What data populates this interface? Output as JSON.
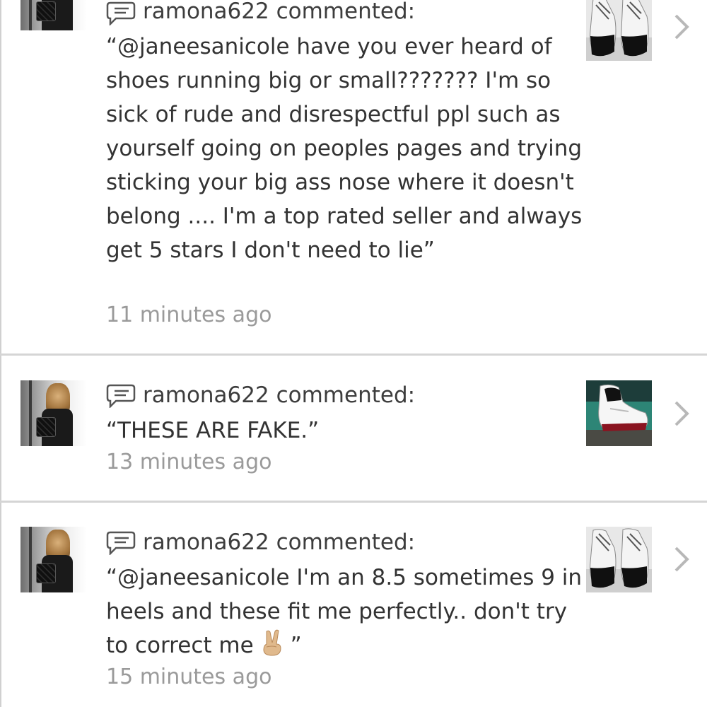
{
  "comments": [
    {
      "username": "ramona622",
      "action": "commented:",
      "text": "“@janeesanicole have you ever heard of shoes running big or small??????? I'm so sick of rude and disrespectful ppl such as yourself going on peoples pages and trying sticking your big ass nose where it doesn't belong .... I'm a top rated seller and always get 5 stars I don't need to lie”",
      "time": "11 minutes ago",
      "thumb_icon": "sneaker-photo-black-white"
    },
    {
      "username": "ramona622",
      "action": "commented:",
      "text": "“THESE ARE FAKE.”",
      "time": "13 minutes ago",
      "thumb_icon": "sneaker-photo-white-red"
    },
    {
      "username": "ramona622",
      "action": "commented:",
      "text_before_emoji": "“@janeesanicole I'm an 8.5 sometimes 9 in heels and these fit me perfectly.. don't try to correct me",
      "text_after_emoji": "”",
      "emoji": "victory-hand-emoji",
      "time": "15 minutes ago",
      "thumb_icon": "sneaker-photo-black-white"
    }
  ],
  "icons": {
    "comment": "speech-bubble-icon",
    "chevron": "chevron-right-icon"
  },
  "colors": {
    "text": "#333333",
    "time": "#9a9a9a",
    "divider": "#d5d5d5",
    "chevron": "#c0c0c0"
  }
}
